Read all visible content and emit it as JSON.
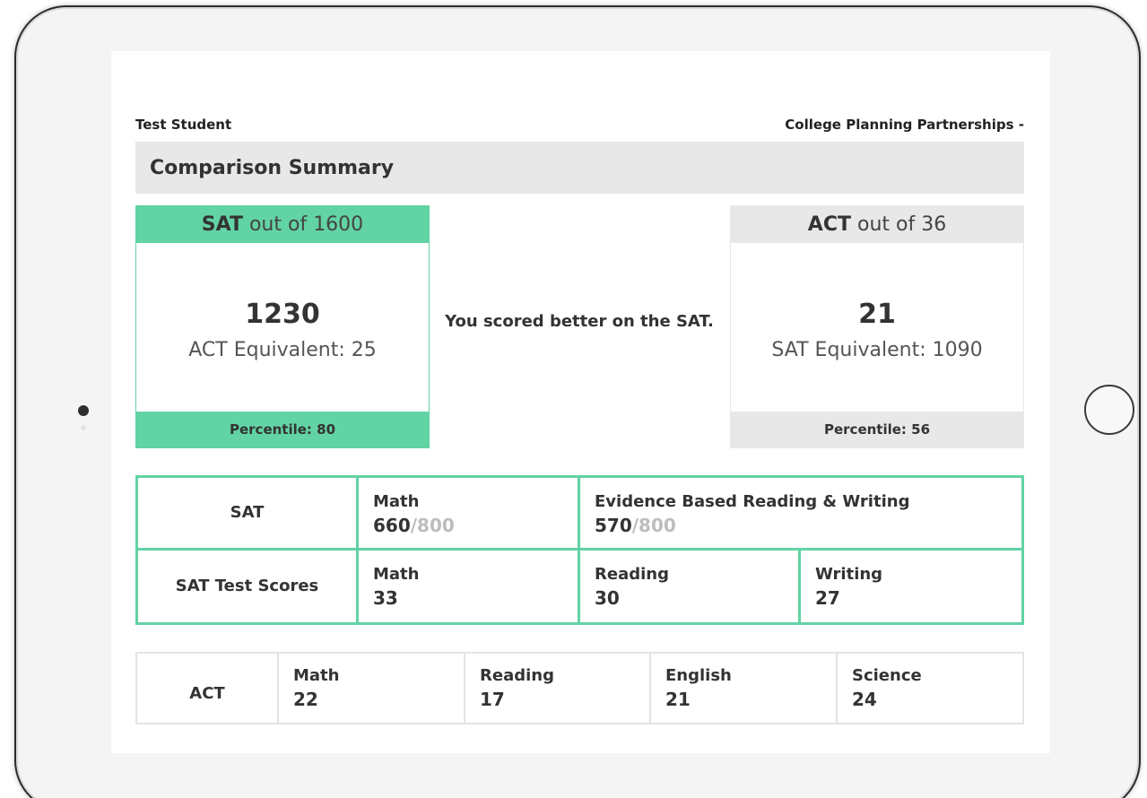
{
  "header": {
    "student_name": "Test Student",
    "organization": "College Planning Partnerships -"
  },
  "summary": {
    "title": "Comparison Summary"
  },
  "sat_card": {
    "label_bold": "SAT",
    "label_light": "out of 1600",
    "score": "1230",
    "equivalent": "ACT Equivalent: 25",
    "percentile": "Percentile: 80"
  },
  "act_card": {
    "label_bold": "ACT",
    "label_light": "out of 36",
    "score": "21",
    "equivalent": "SAT Equivalent: 1090",
    "percentile": "Percentile: 56"
  },
  "comparison_message": "You scored better on the SAT.",
  "sat_table": {
    "row1": {
      "label": "SAT",
      "math": {
        "title": "Math",
        "score": "660",
        "max": "/800"
      },
      "ebrw": {
        "title": "Evidence Based Reading & Writing",
        "score": "570",
        "max": "/800"
      }
    },
    "row2": {
      "label": "SAT Test Scores",
      "math": {
        "title": "Math",
        "score": "33"
      },
      "reading": {
        "title": "Reading",
        "score": "30"
      },
      "writing": {
        "title": "Writing",
        "score": "27"
      }
    }
  },
  "act_table": {
    "label": "ACT",
    "math": {
      "title": "Math",
      "score": "22"
    },
    "reading": {
      "title": "Reading",
      "score": "17"
    },
    "english": {
      "title": "English",
      "score": "21"
    },
    "science": {
      "title": "Science",
      "score": "24"
    }
  },
  "colors": {
    "accent": "#62d3a4",
    "neutral": "#e8e8e8"
  }
}
